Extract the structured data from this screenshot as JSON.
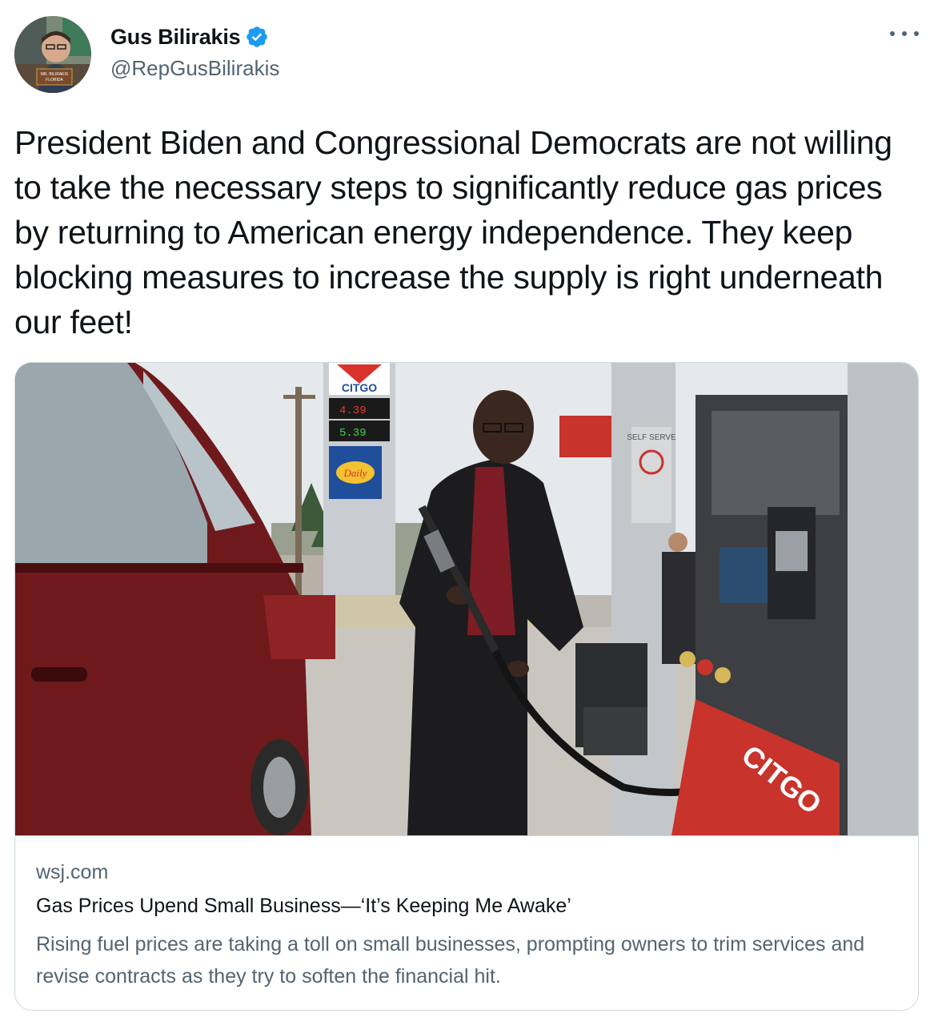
{
  "author": {
    "display_name": "Gus Bilirakis",
    "handle": "@RepGusBilirakis",
    "verified": true,
    "avatar_nameplate_line1": "MR. BILIRAKIS",
    "avatar_nameplate_line2": "FLORIDA"
  },
  "tweet": {
    "text": "President Biden and Congressional Democrats are not willing to take the necessary steps to significantly reduce gas prices by returning to American energy independence. They keep blocking measures to increase the supply is right underneath our feet!"
  },
  "link_card": {
    "domain": "wsj.com",
    "title": "Gas Prices Upend Small Business—‘It’s Keeping Me Awake’",
    "description": "Rising fuel prices are taking a toll on small businesses, prompting owners to trim services and revise contracts as they try to soften the financial hit.",
    "image": {
      "sign_brand": "CITGO",
      "price_regular": "4.39",
      "price_diesel": "5.39",
      "sign_daily": "Daily",
      "pole_sign": "SELF SERVE",
      "pump_brand": "CITGO"
    }
  },
  "icons": {
    "verified_badge": "verified-badge-icon",
    "more_menu": "more-icon"
  },
  "colors": {
    "verified_blue": "#1d9bf0",
    "text_primary": "#0f1419",
    "text_secondary": "#536471",
    "border": "#cfd9de",
    "citgo_red": "#d8322b"
  }
}
